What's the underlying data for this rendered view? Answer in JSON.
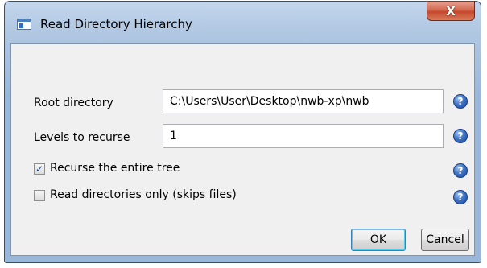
{
  "window": {
    "title": "Read Directory Hierarchy",
    "close_glyph": "X"
  },
  "form": {
    "root_directory": {
      "label": "Root directory",
      "value": "C:\\Users\\User\\Desktop\\nwb-xp\\nwb"
    },
    "levels_to_recurse": {
      "label": "Levels to recurse",
      "value": "1"
    },
    "recurse_entire_tree": {
      "label": "Recurse the entire tree",
      "checked": true,
      "mark": "✓"
    },
    "read_directories_only": {
      "label": "Read directories only (skips files)",
      "checked": false,
      "mark": ""
    },
    "help_glyph": "?"
  },
  "buttons": {
    "ok_label": "OK",
    "cancel_label": "Cancel"
  }
}
